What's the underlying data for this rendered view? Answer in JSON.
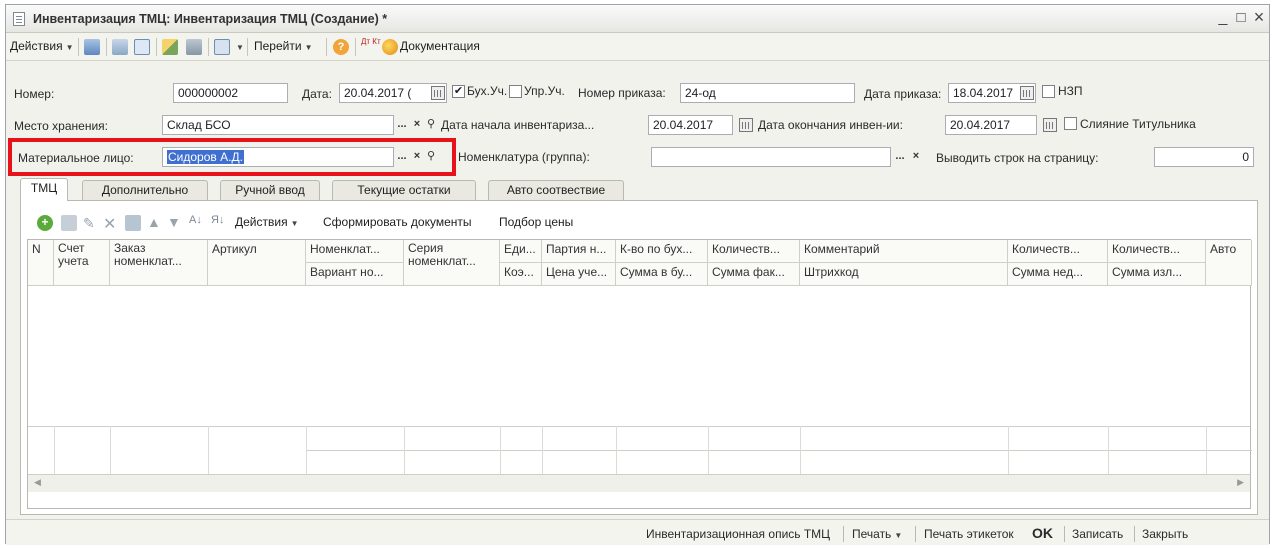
{
  "window": {
    "title": "Инвентаризация ТМЦ: Инвентаризация ТМЦ (Создание) *",
    "minimize": "_",
    "maximize": "□",
    "close": "×"
  },
  "toolbar": {
    "actions": "Действия",
    "goto": "Перейти",
    "documentation": "Документация",
    "dt_kt": "Дт Кт"
  },
  "form": {
    "number_label": "Номер:",
    "number_value": "000000002",
    "date_label": "Дата:",
    "date_value": "20.04.2017 (",
    "buh_label": "Бух.Уч.",
    "buh_checked": "✔",
    "upr_label": "Упр.Уч.",
    "order_label": "Номер приказа:",
    "order_value": "24-од",
    "order_date_label": "Дата приказа:",
    "order_date_value": "18.04.2017",
    "nzp_label": "НЗП",
    "storage_label": "Место хранения:",
    "storage_value": "Склад БСО",
    "start_label": "Дата начала инвентариза...",
    "start_value": "20.04.2017",
    "end_label": "Дата окончания инвен-ии:",
    "end_value": "20.04.2017",
    "merge_label": "Слияние Титульника",
    "person_label": "Материальное лицо:",
    "person_value": "Сидоров А.Д.",
    "nomen_group_label": "Номенклатура (группа):",
    "nomen_group_value": "",
    "rows_label": "Выводить строк на страницу:",
    "rows_value": "0",
    "select_btn": "...",
    "clear_btn": "×"
  },
  "tabs": [
    "ТМЦ",
    "Дополнительно",
    "Ручной ввод",
    "Текущие остатки",
    "Авто соотвествие"
  ],
  "grid_toolbar": {
    "actions": "Действия",
    "create_docs": "Сформировать документы",
    "price_select": "Подбор цены"
  },
  "grid": {
    "headers_top": [
      "N",
      "Счет учета",
      "Заказ номенклат...",
      "Артикул",
      "Номенклат...",
      "Серия номенклат...",
      "Еди...",
      "Партия н...",
      "К-во по бух...",
      "Количеств...",
      "Комментарий",
      "Количеств...",
      "Количеств...",
      "Авто"
    ],
    "headers_bottom": [
      "Вариант но...",
      "Коэ...",
      "Цена уче...",
      "Сумма в бу...",
      "Сумма фак...",
      "Штрихкод",
      "Сумма нед...",
      "Сумма изл..."
    ]
  },
  "footer": {
    "inventory_list": "Инвентаризационная опись ТМЦ",
    "print": "Печать",
    "print_labels": "Печать этикеток",
    "ok": "OK",
    "save": "Записать",
    "close": "Закрыть"
  },
  "colors": {
    "highlight_box": "#e8121b",
    "selection": "#3f6fd0"
  }
}
